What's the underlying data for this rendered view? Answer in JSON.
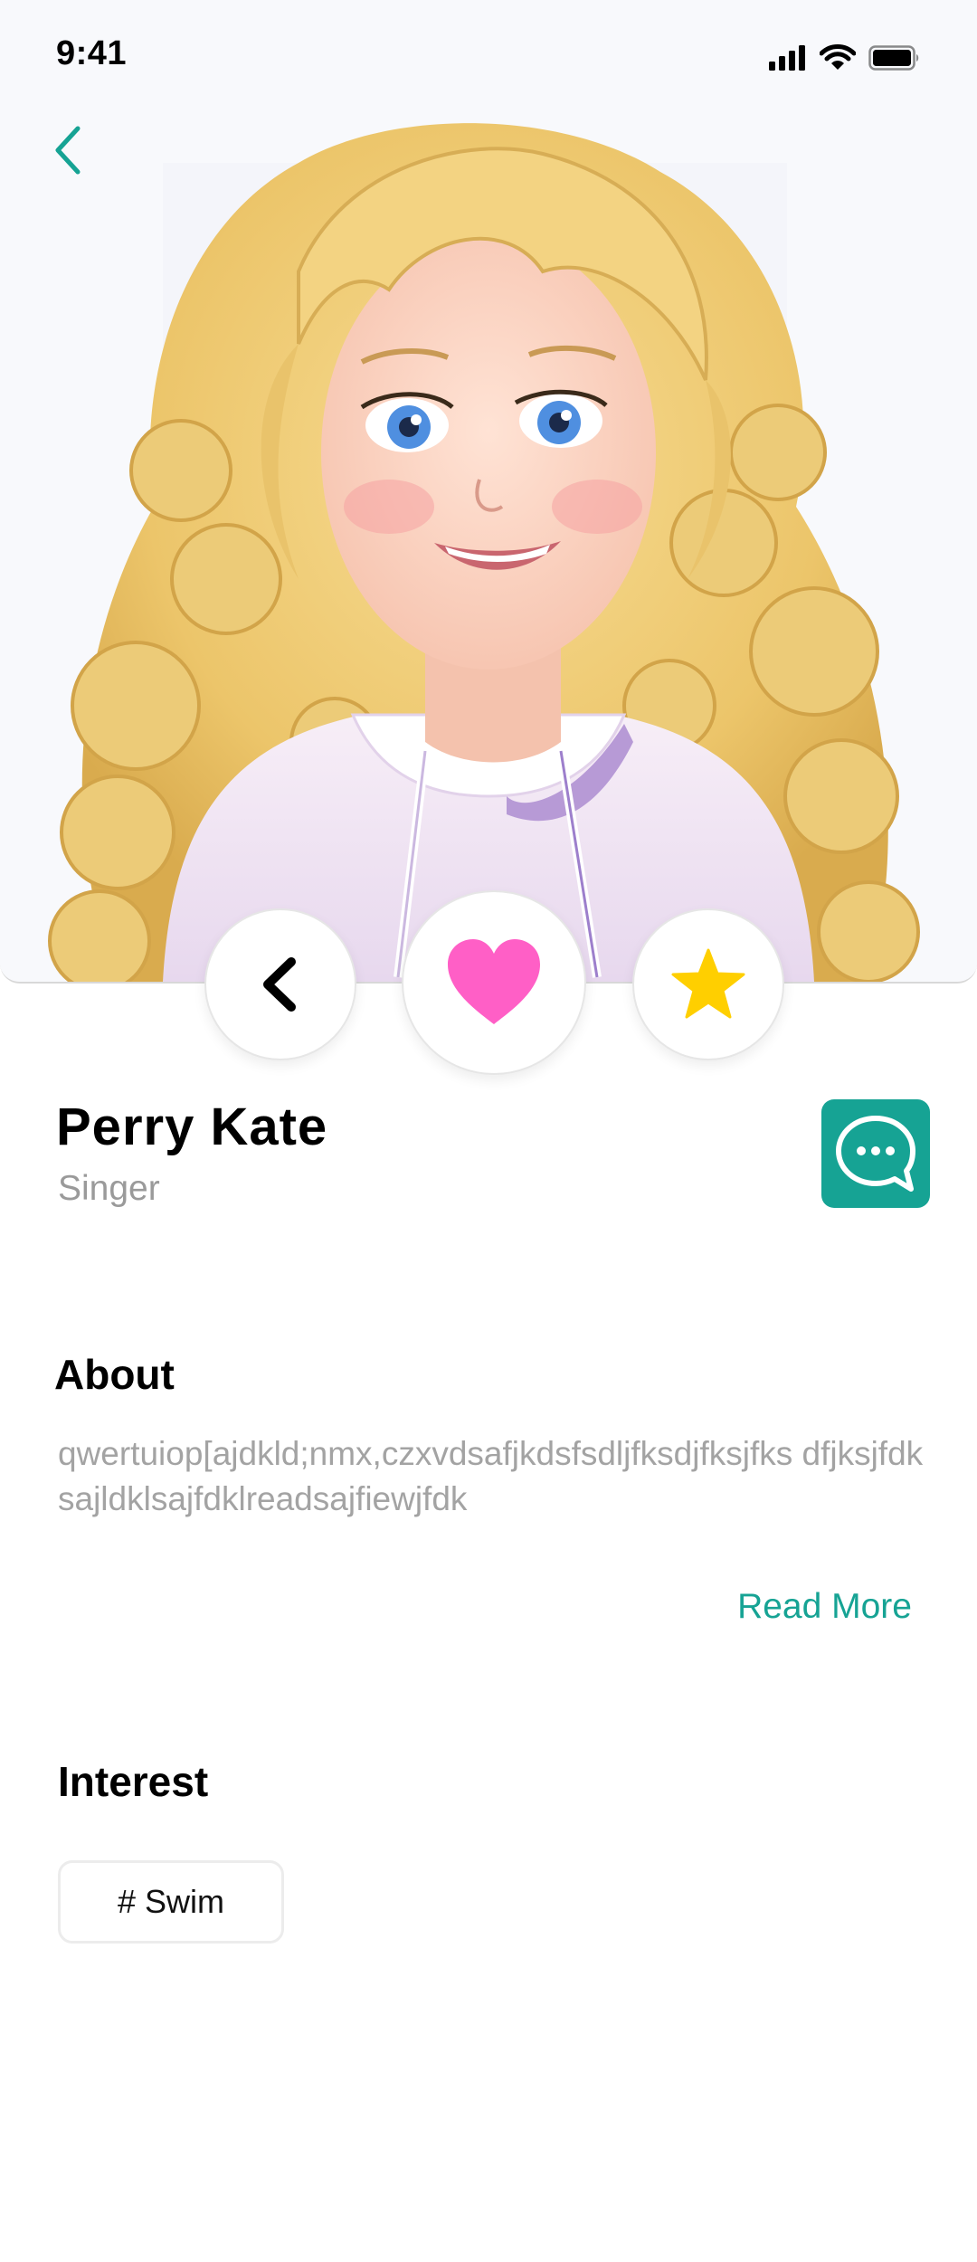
{
  "status_bar": {
    "time": "9:41",
    "icons": [
      "signal-icon",
      "wifi-icon",
      "battery-icon"
    ]
  },
  "hero": {
    "back_icon": "chevron-left-icon",
    "photo": "profile-photo"
  },
  "actions": {
    "undo_icon": "undo-chevron-icon",
    "like_icon": "heart-icon",
    "super_icon": "star-icon"
  },
  "profile": {
    "name": "Perry Kate",
    "job": "Singer"
  },
  "chat": {
    "icon": "chat-bubble-icon"
  },
  "about": {
    "title": "About",
    "text": "qwertuiop[ajdkld;nmx,czxvdsafjkdsfsdljfksdjfksjfks dfjksjfdksajldklsajfdklreadsajfiewjfdk",
    "read_more": "Read More"
  },
  "interest": {
    "title": "Interest",
    "tags": [
      "# Swim"
    ]
  },
  "colors": {
    "accent": "#16a394",
    "heart": "#ff5fc6",
    "star": "#ffcf00",
    "muted_text": "#a3a3a3"
  }
}
